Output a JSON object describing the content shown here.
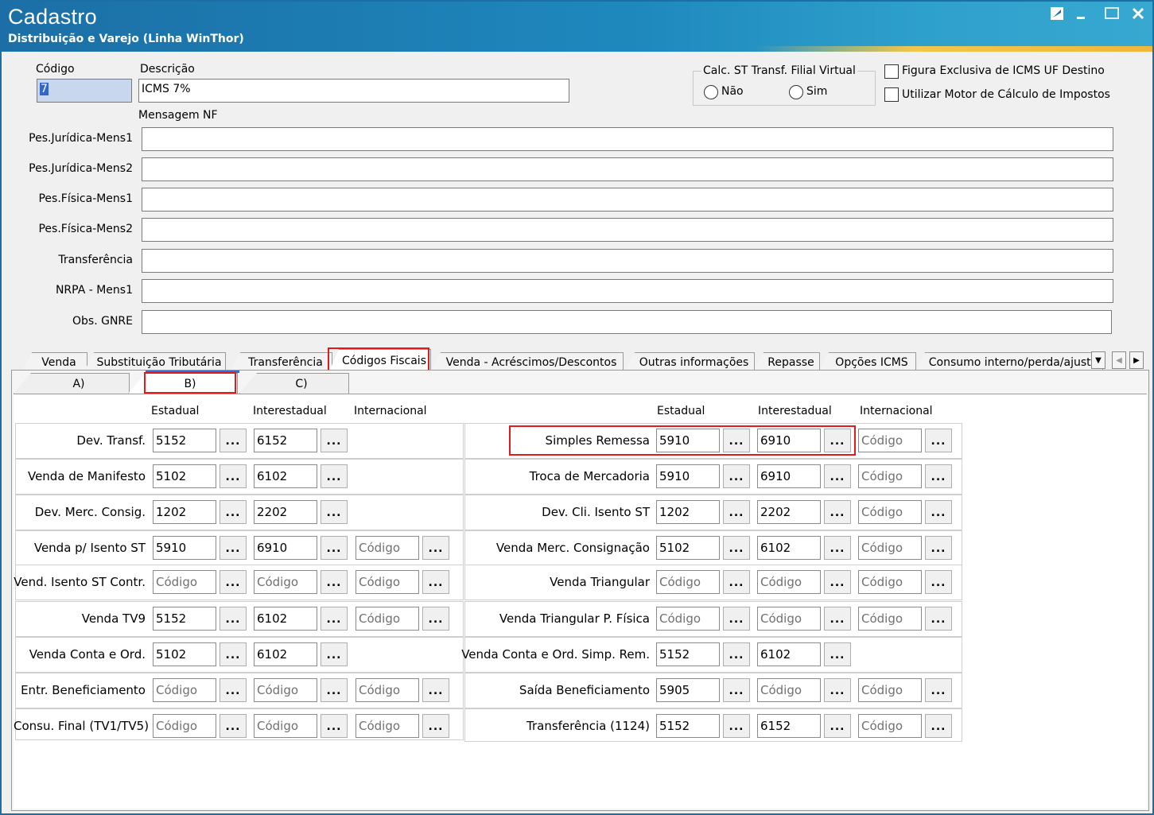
{
  "window": {
    "title": "Cadastro",
    "subtitle": "Distribuição e Varejo (Linha WinThor)",
    "controls": [
      "edit-icon",
      "minimize-icon",
      "maximize-icon",
      "close-icon"
    ]
  },
  "header": {
    "codigo_label": "Código",
    "codigo_value": "7",
    "descricao_label": "Descrição",
    "descricao_value": "ICMS 7%",
    "mensagem_nf_label": "Mensagem NF",
    "calc_st_label": "Calc. ST Transf. Filial Virtual",
    "radio_nao": "Não",
    "radio_sim": "Sim",
    "check_figura": "Figura Exclusiva de ICMS UF Destino",
    "check_motor": "Utilizar Motor de Cálculo de Impostos"
  },
  "messages": [
    {
      "label": "Pes.Jurídica-Mens1",
      "value": ""
    },
    {
      "label": "Pes.Jurídica-Mens2",
      "value": ""
    },
    {
      "label": "Pes.Física-Mens1",
      "value": ""
    },
    {
      "label": "Pes.Física-Mens2",
      "value": ""
    },
    {
      "label": "Transferência",
      "value": ""
    },
    {
      "label": "NRPA - Mens1",
      "value": ""
    },
    {
      "label": "Obs. GNRE",
      "value": ""
    }
  ],
  "tabs": [
    "Venda",
    "Substituição Tributária",
    "Transferência",
    "Códigos Fiscais",
    "Venda - Acréscimos/Descontos",
    "Outras informações",
    "Repasse",
    "Opções ICMS",
    "Consumo interno/perda/ajuste"
  ],
  "active_tab": "Códigos Fiscais",
  "subtabs": [
    "A)",
    "B)",
    "C)"
  ],
  "active_subtab": "B)",
  "columns": {
    "estadual": "Estadual",
    "interestadual": "Interestadual",
    "internacional": "Internacional"
  },
  "placeholder": "Código",
  "dots_label": "...",
  "left_rows": [
    {
      "label": "Dev. Transf.",
      "estadual": "5152",
      "interestadual": "6152",
      "internacional": null
    },
    {
      "label": "Venda de Manifesto",
      "estadual": "5102",
      "interestadual": "6102",
      "internacional": null
    },
    {
      "label": "Dev. Merc. Consig.",
      "estadual": "1202",
      "interestadual": "2202",
      "internacional": null
    },
    {
      "label": "Venda p/ Isento ST",
      "estadual": "5910",
      "interestadual": "6910",
      "internacional": ""
    },
    {
      "label": "Vend. Isento ST Contr.",
      "estadual": "",
      "interestadual": "",
      "internacional": ""
    },
    {
      "label": "Venda TV9",
      "estadual": "5152",
      "interestadual": "6102",
      "internacional": ""
    },
    {
      "label": "Venda Conta e Ord.",
      "estadual": "5102",
      "interestadual": "6102",
      "internacional": null
    },
    {
      "label": "Entr. Beneficiamento",
      "estadual": "",
      "interestadual": "",
      "internacional": ""
    },
    {
      "label": "Consu. Final (TV1/TV5)",
      "estadual": "",
      "interestadual": "",
      "internacional": ""
    }
  ],
  "right_rows": [
    {
      "label": "Simples Remessa",
      "estadual": "5910",
      "interestadual": "6910",
      "internacional": ""
    },
    {
      "label": "Troca de Mercadoria",
      "estadual": "5910",
      "interestadual": "6910",
      "internacional": ""
    },
    {
      "label": "Dev. Cli. Isento ST",
      "estadual": "1202",
      "interestadual": "2202",
      "internacional": ""
    },
    {
      "label": "Venda Merc. Consignação",
      "estadual": "5102",
      "interestadual": "6102",
      "internacional": ""
    },
    {
      "label": "Venda Triangular",
      "estadual": "",
      "interestadual": "",
      "internacional": ""
    },
    {
      "label": "Venda Triangular P. Física",
      "estadual": "",
      "interestadual": "",
      "internacional": ""
    },
    {
      "label": "Venda Conta e Ord. Simp. Rem.",
      "estadual": "5152",
      "interestadual": "6102",
      "internacional": null
    },
    {
      "label": "Saída Beneficiamento",
      "estadual": "5905",
      "interestadual": "",
      "internacional": ""
    },
    {
      "label": "Transferência (1124)",
      "estadual": "5152",
      "interestadual": "6152",
      "internacional": ""
    }
  ],
  "colors": {
    "title_bar": "#1b6fa6",
    "highlight": "#e01b1b",
    "active_subtab_bar": "#2d6fd1"
  }
}
